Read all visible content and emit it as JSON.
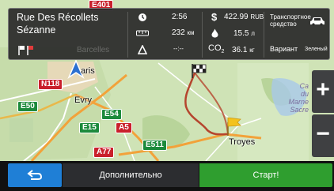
{
  "info_panel": {
    "address_line1": "Rue Des Récollets",
    "address_line2": "Sézanne",
    "time": "2:56",
    "distance_value": "232",
    "distance_unit": "км",
    "eta": "--:--",
    "cost": "422.99",
    "cost_currency": "RUB",
    "fuel_value": "15.5",
    "fuel_unit": "л",
    "co2_label": "CO",
    "co2_sub": "2",
    "co2_value": "36.1",
    "co2_unit": "кг",
    "vehicle_line1": "Транспортное",
    "vehicle_line2": "средство",
    "variant_label": "Вариант",
    "variant_value": "Зеленый",
    "faded_label": "Barcelles"
  },
  "map": {
    "city_paris": "aris",
    "city_evry": "Evry",
    "city_troyes": "Troyes",
    "right_label_line1": "Ca",
    "right_label_line2": "du",
    "right_label_line3": "Marne",
    "right_label_line4": "Sacre",
    "road_n118": "N118",
    "road_e50": "E50",
    "road_e54": "E54",
    "road_e15": "E15",
    "road_a5": "A5",
    "road_e511": "E511",
    "road_a77": "A77",
    "road_top": "E401"
  },
  "zoom": {
    "in_label": "+",
    "out_label": "−"
  },
  "bottom_bar": {
    "more_label": "Дополнительно",
    "start_label": "Старт!"
  },
  "colors": {
    "route": "#b5452e",
    "start_button": "#2f9e2f",
    "back_button": "#1f7fd6",
    "panel": "#2a2a2a"
  }
}
